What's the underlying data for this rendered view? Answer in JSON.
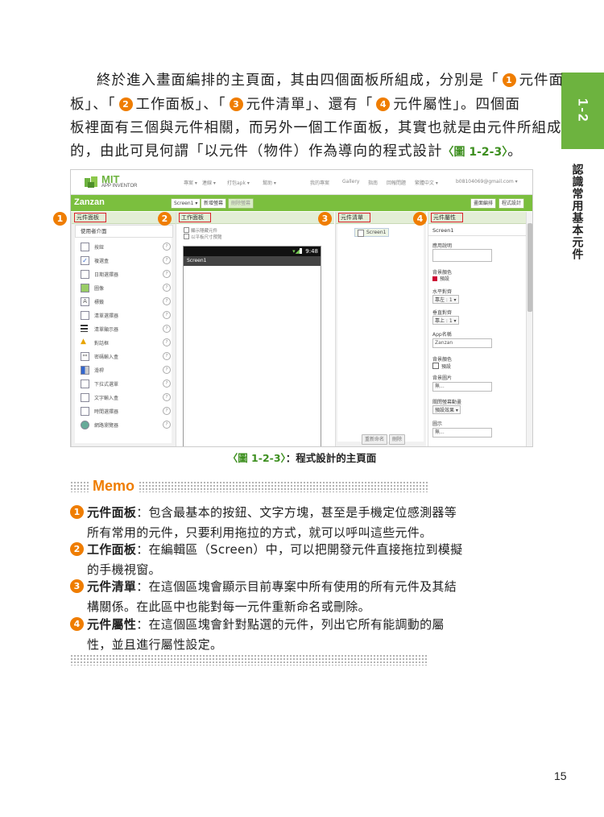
{
  "section": {
    "number": "1-2",
    "title": "認識常用基本元件"
  },
  "intro": {
    "line1_a": "終於進入畫面編排的主頁面，其由四個面板所組成，分別是「",
    "line1_b": "元件面",
    "line2_a": "板」、「",
    "line2_b": "工作面板」、「",
    "line2_c": "元件清單」、還有「",
    "line2_d": "元件屬性」。四個面",
    "line3": "板裡面有三個與元件相關，而另外一個工作面板，其實也就是由元件所組成",
    "line4": "的，由此可見何謂「以元件（物件）作為導向的程式設計",
    "line4_ref": "〈圖 1-2-3〉",
    "line4_end": "。"
  },
  "markers": [
    "1",
    "2",
    "3",
    "4"
  ],
  "screenshot": {
    "logo": {
      "name": "MIT",
      "sub": "APP INVENTOR"
    },
    "top_menu": [
      "專案 ▾",
      "連線 ▾",
      "打包apk ▾",
      "幫助 ▾"
    ],
    "top_right": [
      "我的專案",
      "Gallery",
      "指南",
      "回報問題",
      "繁體中文 ▾",
      "b08104069@gmail.com ▾"
    ],
    "project_name": "Zanzan",
    "screen_select": "Screen1 ▾",
    "add_screen": "新增螢幕",
    "remove_screen": "刪除螢幕",
    "designer_btn": "畫面編排",
    "blocks_btn": "程式設計",
    "palette": {
      "title": "元件面板",
      "category": "使用者介面",
      "items": [
        "按鈕",
        "複選盒",
        "日期選擇器",
        "圖像",
        "標籤",
        "清單選擇器",
        "清單顯示器",
        "對話框",
        "密碼輸入盒",
        "滑桿",
        "下拉式選單",
        "文字輸入盒",
        "時間選擇器",
        "網路瀏覽器"
      ]
    },
    "viewer": {
      "title": "工作面板",
      "opt1": "顯示隱藏元件",
      "opt2": "以平板尺寸預覽",
      "time": "9:48",
      "screen_title": "Screen1"
    },
    "components": {
      "title": "元件清單",
      "root": "Screen1",
      "rename_btn": "重新命名",
      "delete_btn": "刪除"
    },
    "properties": {
      "title": "元件屬性",
      "component": "Screen1",
      "fields": [
        {
          "label": "應用說明",
          "value": ""
        },
        {
          "label": "背景顏色",
          "value": "預設"
        },
        {
          "label": "水平對齊",
          "value": "靠左 : 1 ▾"
        },
        {
          "label": "垂直對齊",
          "value": "靠上 : 1 ▾"
        },
        {
          "label": "App名稱",
          "value": "Zanzan"
        },
        {
          "label": "背景顏色",
          "value": "預設"
        },
        {
          "label": "背景圖片",
          "value": "無..."
        },
        {
          "label": "關閉螢幕動畫",
          "value": "預設效果 ▾"
        },
        {
          "label": "圖示",
          "value": "無..."
        }
      ]
    }
  },
  "caption": {
    "ref": "〈圖 1-2-3〉",
    "text": "：程式設計的主頁面"
  },
  "memo": {
    "title": "Memo",
    "items": [
      {
        "num": "1",
        "term": "元件面板",
        "line1": "：包含最基本的按鈕、文字方塊，甚至是手機定位感測器等",
        "line2": "所有常用的元件，只要利用拖拉的方式，就可以呼叫這些元件。"
      },
      {
        "num": "2",
        "term": "工作面板",
        "line1": "：在編輯區（Screen）中，可以把開發元件直接拖拉到模擬",
        "line2": "的手機視窗。"
      },
      {
        "num": "3",
        "term": "元件清單",
        "line1": "：在這個區塊會顯示目前專案中所有使用的所有元件及其結",
        "line2": "構關係。在此區中也能對每一元件重新命名或刪除。"
      },
      {
        "num": "4",
        "term": "元件屬性",
        "line1": "：在這個區塊會針對點選的元件，列出它所有能調動的屬",
        "line2": "性，並且進行屬性設定。"
      }
    ]
  },
  "page_number": "15",
  "colors": {
    "accent_green": "#6db33f",
    "marker_orange": "#ef7d00",
    "highlight_red": "#d9222a"
  }
}
